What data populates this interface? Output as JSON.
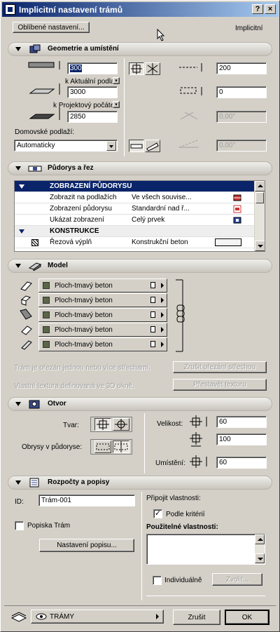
{
  "window": {
    "title": "Implicitní nastavení trámů",
    "help_btn": "?",
    "close_btn": "×"
  },
  "top": {
    "favorites_button": "Oblíbené nastavení...",
    "mode_label": "Implicitní"
  },
  "geometry": {
    "title": "Geometrie a umístění",
    "height_value": "300",
    "floor_ref_label": "k Aktuální podlaží",
    "offset_value": "3000",
    "origin_ref_label": "k Projektový počátek",
    "elevation_value": "2850",
    "home_floor_label": "Domovské podlaží:",
    "home_floor_value": "Automaticky",
    "width_value": "200",
    "offset_right_value": "0",
    "angle1_value": "0,00°",
    "angle2_value": "0,00°"
  },
  "floorplan": {
    "title": "Půdorys a řez",
    "rows": [
      {
        "kind": "hdr",
        "label": "ZOBRAZENÍ PŮDORYSU",
        "value": ""
      },
      {
        "kind": "row",
        "label": "Zobrazit na podlažích",
        "value": "Ve všech souvise..."
      },
      {
        "kind": "row",
        "label": "Zobrazení půdorysu",
        "value": "Standardní nad ř..."
      },
      {
        "kind": "row",
        "label": "Ukázat zobrazení",
        "value": "Celý prvek"
      },
      {
        "kind": "grp",
        "label": "KONSTRUKCE",
        "value": ""
      },
      {
        "kind": "row",
        "label": "Řezová výplň",
        "value": "Konstrukční beton"
      }
    ]
  },
  "model": {
    "title": "Model",
    "materials": [
      "Ploch-tmavý beton",
      "Ploch-tmavý beton",
      "Ploch-tmavý beton",
      "Ploch-tmavý beton",
      "Ploch-tmavý beton"
    ],
    "roof_trim_text": "Trám je ořezán jednou nebo více střechami.",
    "roof_trim_button": "Zrušit ořezání střechou",
    "texture_text": "Vlastní textura definovaná ve 3D okně.",
    "texture_button": "Přestavět texturu"
  },
  "hole": {
    "title": "Otvor",
    "shape_label": "Tvar:",
    "outlines_label": "Obrysy v půdoryse:",
    "size_label": "Velikost:",
    "size_w": "60",
    "size_h": "100",
    "placement_label": "Umístění:",
    "placement_value": "60"
  },
  "listing": {
    "title": "Rozpočty a popisy",
    "id_label": "ID:",
    "id_value": "Trám-001",
    "label_check": "Popiska Trám",
    "label_settings_button": "Nastavení popisu...",
    "link_props_label": "Připojit vlastnosti:",
    "criteria_check": "Podle kritérií",
    "available_props_label": "Použitelné vlastnosti:",
    "individual_check": "Individuálně",
    "choose_button": "Zvolit..."
  },
  "footer": {
    "layer_value": "TRÁMY",
    "cancel_button": "Zrušit",
    "ok_button": "OK"
  }
}
